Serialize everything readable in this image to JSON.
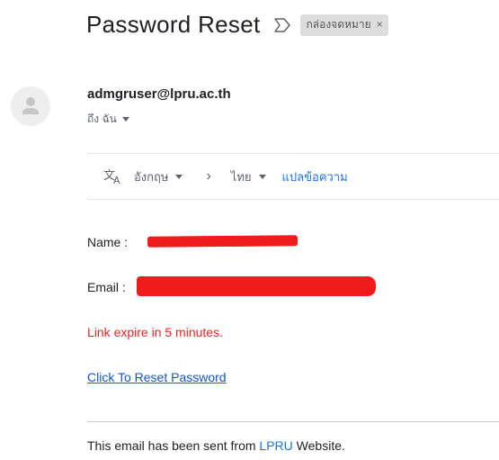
{
  "email": {
    "subject": "Password Reset",
    "label_chip": "กล่องจดหมาย",
    "label_close": "×",
    "sender": "admgruser@lpru.ac.th",
    "recipient": "ถึง ฉัน"
  },
  "translate_bar": {
    "from_language": "อังกฤษ",
    "arrow": "›",
    "to_language": "ไทย",
    "translate_label": "แปลข้อความ"
  },
  "body": {
    "name_label": "Name :",
    "email_label": "Email :",
    "expire_text": "Link expire in 5 minutes.",
    "reset_link": "Click To Reset Password",
    "footer_prefix": "This email has been sent from ",
    "footer_brand": "LPRU",
    "footer_suffix": " Website."
  },
  "colors": {
    "redaction": "#ee1c1c",
    "link_blue": "#1155cc",
    "warning_red": "#ee2222"
  },
  "icons": {
    "importance": "importance-marker-icon",
    "avatar": "person-icon",
    "translate": "translate-icon"
  }
}
